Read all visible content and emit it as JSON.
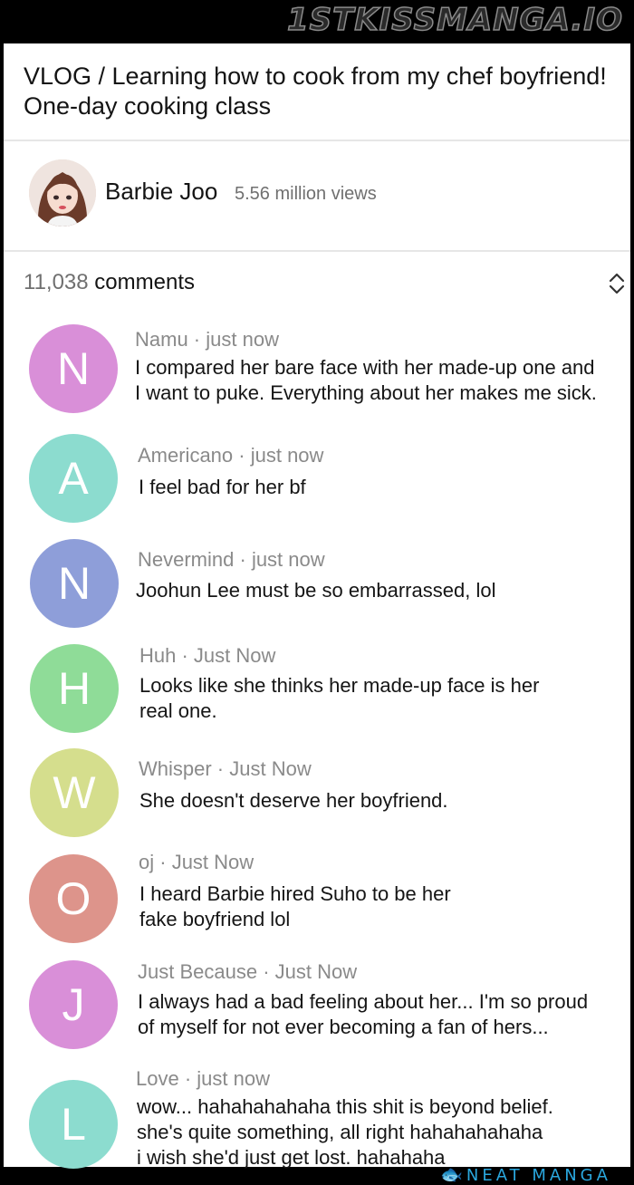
{
  "watermark_top": "1STKISSMANGA.IO",
  "video": {
    "title": "VLOG / Learning how to cook from my chef boyfriend! One-day cooking class",
    "channel": "Barbie Joo",
    "views": "5.56 million views"
  },
  "comments_header": {
    "count": "11,038",
    "label": "comments",
    "sort_icon": "chevron-up-down-icon"
  },
  "comments": [
    {
      "initial": "N",
      "color": "#d98fd8",
      "author": "Namu",
      "time": "just now",
      "lines": [
        "I compared her bare face with her made-up one and",
        "I want to puke. Everything about her makes me sick."
      ]
    },
    {
      "initial": "A",
      "color": "#8cdccf",
      "author": "Americano",
      "time": "just now",
      "lines": [
        "I feel bad for her bf"
      ]
    },
    {
      "initial": "N",
      "color": "#8e9ed9",
      "author": "Nevermind",
      "time": "just now",
      "lines": [
        "Joohun Lee must be so embarrassed, lol"
      ]
    },
    {
      "initial": "H",
      "color": "#8fdc98",
      "author": "Huh",
      "time": "Just Now",
      "lines": [
        "Looks like she thinks her made-up face is her",
        "real one."
      ]
    },
    {
      "initial": "W",
      "color": "#d5de8d",
      "author": "Whisper",
      "time": "Just Now",
      "lines": [
        "She doesn't deserve her boyfriend."
      ]
    },
    {
      "initial": "O",
      "color": "#dd948b",
      "author": "oj",
      "time": "Just Now",
      "lines": [
        "I heard Barbie hired Suho to be her",
        "fake boyfriend lol"
      ]
    },
    {
      "initial": "J",
      "color": "#d98fd8",
      "author": "Just Because",
      "time": "Just Now",
      "lines": [
        "I always had a bad feeling about her... I'm so proud",
        "of myself for not ever becoming a fan of hers..."
      ]
    },
    {
      "initial": "L",
      "color": "#8cdccf",
      "author": "Love",
      "time": "just now",
      "lines": [
        "wow... hahahahahaha this shit is beyond belief.",
        "she's quite something, all right hahahahahaha",
        "i wish she'd just get lost. hahahaha"
      ]
    }
  ],
  "watermark_bottom": "NEAT MANGA"
}
